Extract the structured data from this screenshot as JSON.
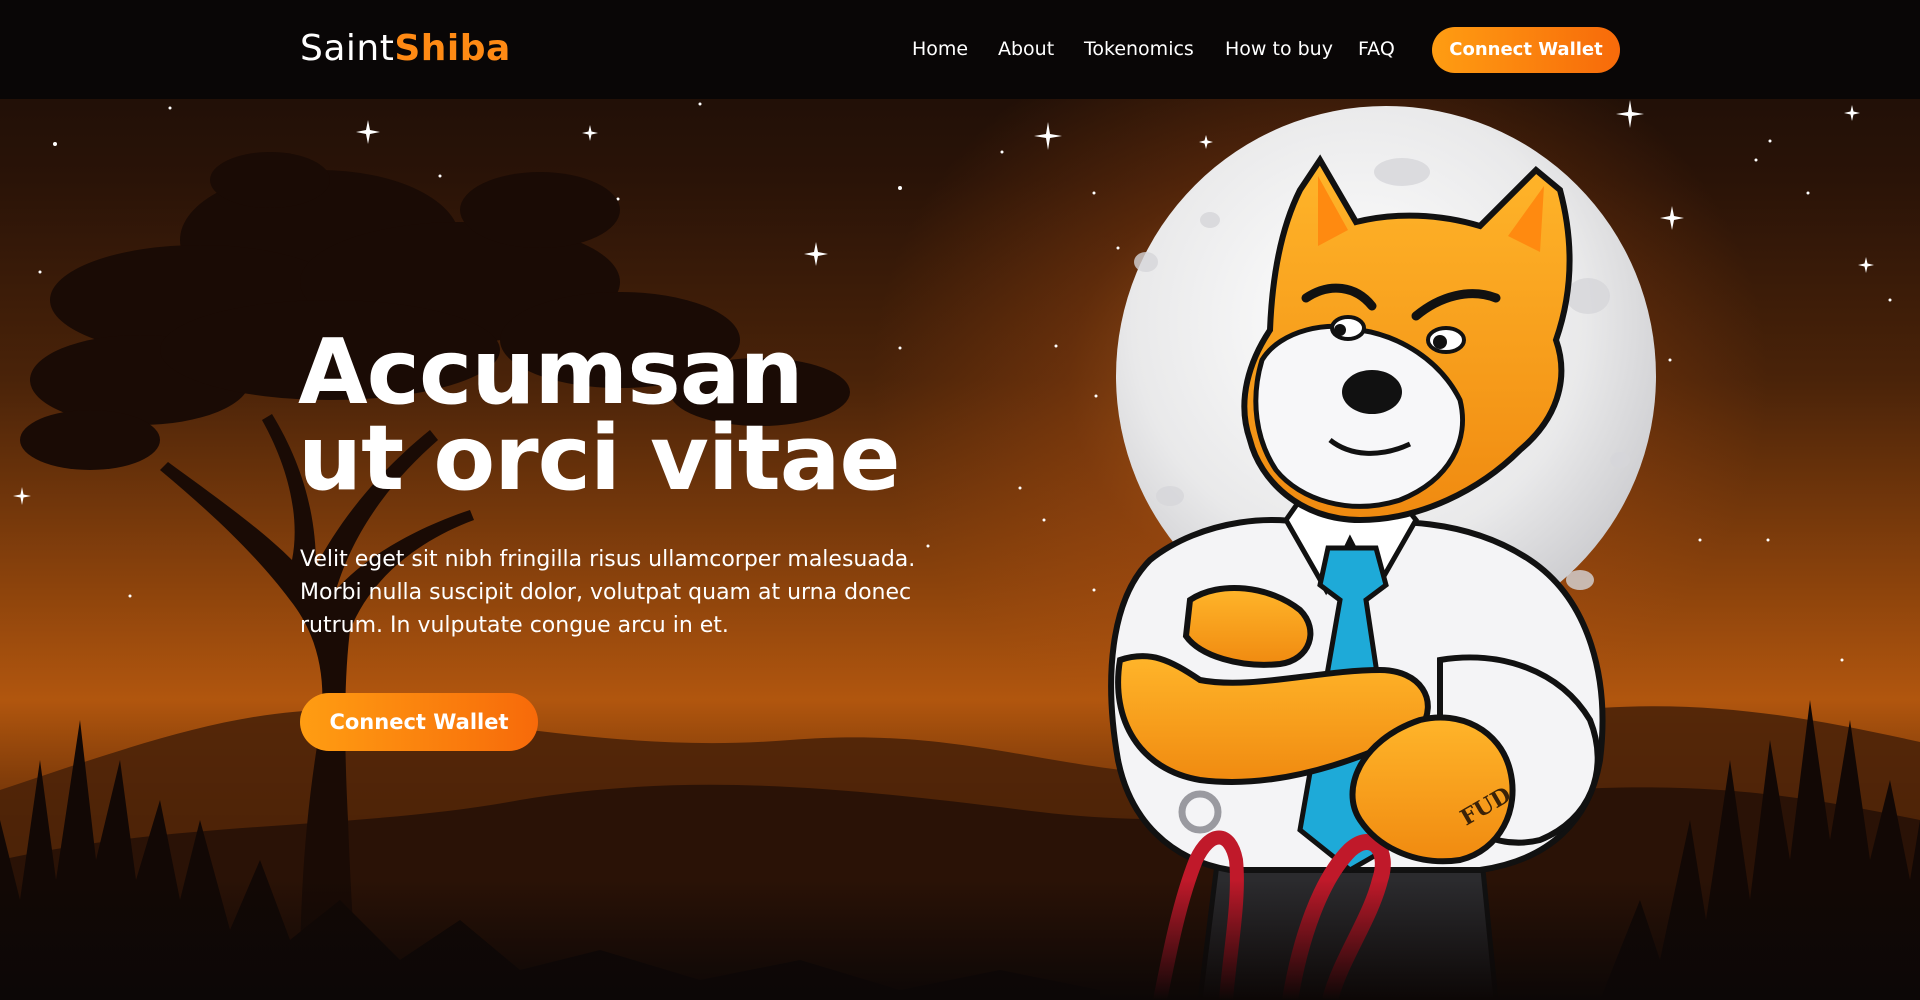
{
  "brand": {
    "part1": "Saint",
    "part2": "Shiba"
  },
  "nav": {
    "items": [
      {
        "label": "Home"
      },
      {
        "label": "About"
      },
      {
        "label": "Tokenomics"
      },
      {
        "label": "How to buy"
      },
      {
        "label": "FAQ"
      }
    ],
    "cta_label": "Connect Wallet"
  },
  "hero": {
    "title_line1": "Accumsan",
    "title_line2": "ut orci vitae",
    "description": "Velit eget sit nibh fringilla risus ullamcorper malesuada. Morbi nulla suscipit dolor, volutpat quam at urna donec rutrum. In vulputate congue arcu in et.",
    "cta_label": "Connect Wallet",
    "mascot_sleeve_text": "FUD"
  },
  "colors": {
    "accent": "#ff8a14",
    "button_gradient_start": "#ff9d12",
    "button_gradient_end": "#f76a0a",
    "header_bg": "#090606",
    "mascot_fur": "#f7a21b",
    "tie": "#1eaad8",
    "leash": "#c0192a"
  },
  "icons": [
    "star-icon",
    "moon-illustration",
    "acacia-tree-illustration",
    "shiba-mascot-illustration"
  ]
}
